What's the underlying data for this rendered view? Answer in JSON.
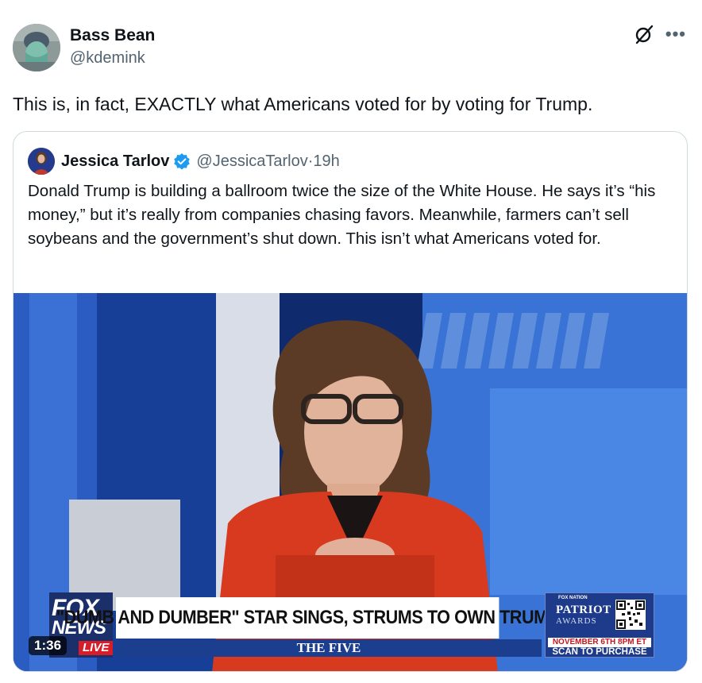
{
  "tweet": {
    "author_name": "Bass Bean",
    "author_handle": "@kdemink",
    "text": "This is, in fact, EXACTLY what Americans voted for by voting for Trump.",
    "more_icon": "•••"
  },
  "quote": {
    "author_name": "Jessica Tarlov",
    "author_handle": "@JessicaTarlov",
    "separator": " · ",
    "time": "19h",
    "text": "Donald Trump is building a ballroom twice the size of the White House. He says it’s “his money,” but it’s really from companies chasing favors. Meanwhile, farmers can’t sell soybeans and the government’s shut down. This isn’t what Americans voted for.",
    "verified_color": "#1d9bf0"
  },
  "video": {
    "duration": "1:36",
    "chyron": "\"DUMB AND DUMBER\" STAR SINGS, STRUMS TO OWN TRUMP",
    "show_name": "THE FIVE",
    "network_line1": "FOX",
    "network_line2": "NEWS",
    "network_live": "LIVE",
    "promo_brand": "FOX NATION",
    "promo_title": "PATRIOT",
    "promo_subtitle": "AWARDS",
    "promo_date": "NOVEMBER 6TH 8PM ET",
    "promo_cta": "SCAN TO PURCHASE"
  },
  "icons": {
    "grok": "grok-icon",
    "more": "more-icon",
    "verified": "verified-badge-icon"
  },
  "colors": {
    "text": "#0f1419",
    "secondary": "#536471",
    "border": "#cfd9de"
  }
}
